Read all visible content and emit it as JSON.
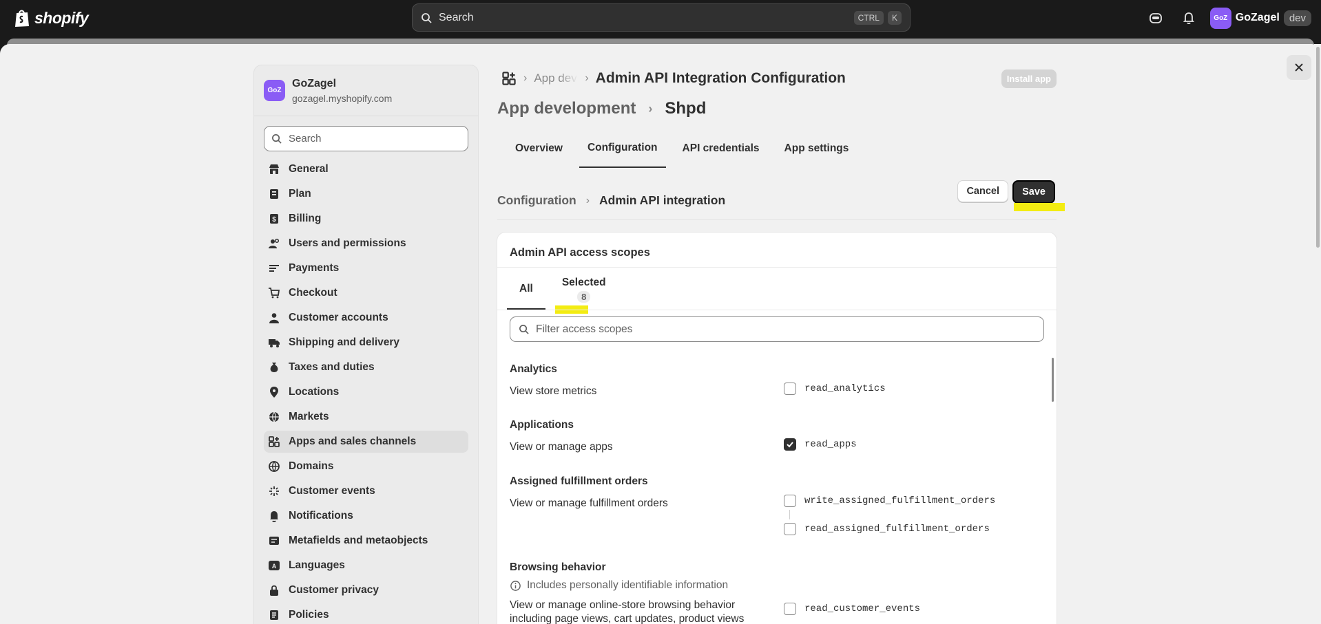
{
  "topbar": {
    "logo_text": "shopify",
    "search_placeholder": "Search",
    "kbd_ctrl": "CTRL",
    "kbd_k": "K",
    "store_initials": "GoZ",
    "store_name": "GoZagel",
    "env_badge": "dev"
  },
  "sidebar": {
    "store_initials": "GoZ",
    "store_name": "GoZagel",
    "store_domain": "gozagel.myshopify.com",
    "search_placeholder": "Search",
    "items": [
      {
        "label": "General",
        "icon": "store-icon"
      },
      {
        "label": "Plan",
        "icon": "plan-icon"
      },
      {
        "label": "Billing",
        "icon": "billing-icon"
      },
      {
        "label": "Users and permissions",
        "icon": "users-icon"
      },
      {
        "label": "Payments",
        "icon": "payments-icon"
      },
      {
        "label": "Checkout",
        "icon": "cart-icon"
      },
      {
        "label": "Customer accounts",
        "icon": "person-icon"
      },
      {
        "label": "Shipping and delivery",
        "icon": "truck-icon"
      },
      {
        "label": "Taxes and duties",
        "icon": "money-bag-icon"
      },
      {
        "label": "Locations",
        "icon": "location-pin-icon"
      },
      {
        "label": "Markets",
        "icon": "globe-icon"
      },
      {
        "label": "Apps and sales channels",
        "icon": "apps-icon",
        "active": true
      },
      {
        "label": "Domains",
        "icon": "domain-icon"
      },
      {
        "label": "Customer events",
        "icon": "sparkle-icon"
      },
      {
        "label": "Notifications",
        "icon": "bell-icon"
      },
      {
        "label": "Metafields and metaobjects",
        "icon": "metafields-icon"
      },
      {
        "label": "Languages",
        "icon": "language-icon"
      },
      {
        "label": "Customer privacy",
        "icon": "lock-icon"
      },
      {
        "label": "Policies",
        "icon": "policy-icon"
      }
    ]
  },
  "main": {
    "breadcrumb_faded": "App dev",
    "breadcrumb_title": "Admin API Integration Configuration",
    "install_label": "Install app",
    "page_head_parent": "App development",
    "page_head_app": "Shpd",
    "tabs": [
      "Overview",
      "Configuration",
      "API credentials",
      "App settings"
    ],
    "active_tab": "Configuration",
    "sub_parent": "Configuration",
    "sub_current": "Admin API integration",
    "cancel_label": "Cancel",
    "save_label": "Save",
    "card": {
      "title": "Admin API access scopes",
      "tab_all": "All",
      "tab_selected": "Selected",
      "selected_count": "8",
      "filter_placeholder": "Filter access scopes",
      "sections": [
        {
          "title": "Analytics",
          "desc": "View store metrics",
          "scopes": [
            {
              "name": "read_analytics",
              "checked": false
            }
          ]
        },
        {
          "title": "Applications",
          "desc": "View or manage apps",
          "scopes": [
            {
              "name": "read_apps",
              "checked": true
            }
          ]
        },
        {
          "title": "Assigned fulfillment orders",
          "desc": "View or manage fulfillment orders",
          "scopes": [
            {
              "name": "write_assigned_fulfillment_orders",
              "checked": false
            },
            {
              "name": "read_assigned_fulfillment_orders",
              "checked": false
            }
          ]
        },
        {
          "title": "Browsing behavior",
          "pii_note": "Includes personally identifiable information",
          "desc": "View or manage online-store browsing behavior including page views, cart updates, product views",
          "scopes": [
            {
              "name": "read_customer_events",
              "checked": false
            }
          ]
        }
      ]
    }
  },
  "colors": {
    "brand_purple": "#8a5cf5",
    "highlight": "#f3ec12",
    "primary": "#303030"
  }
}
